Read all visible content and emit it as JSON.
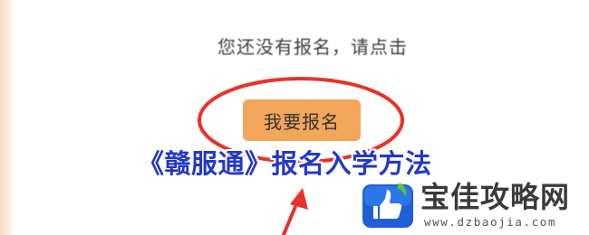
{
  "prompt": {
    "text": "您还没有报名，请点击"
  },
  "signup_button": {
    "label": "我要报名"
  },
  "overlay": {
    "title": "《赣服通》报名入学方法"
  },
  "watermark": {
    "site_name": "宝佳攻略网",
    "url": "www.dzbaojia.com",
    "logo_icon": "thumbs-up-icon"
  },
  "colors": {
    "annotation_red": "#e8322a",
    "button_orange": "#f2a65a",
    "title_blue": "#2338c7",
    "logo_blue": "#1f5fd6",
    "logo_green": "#5cc43a"
  }
}
